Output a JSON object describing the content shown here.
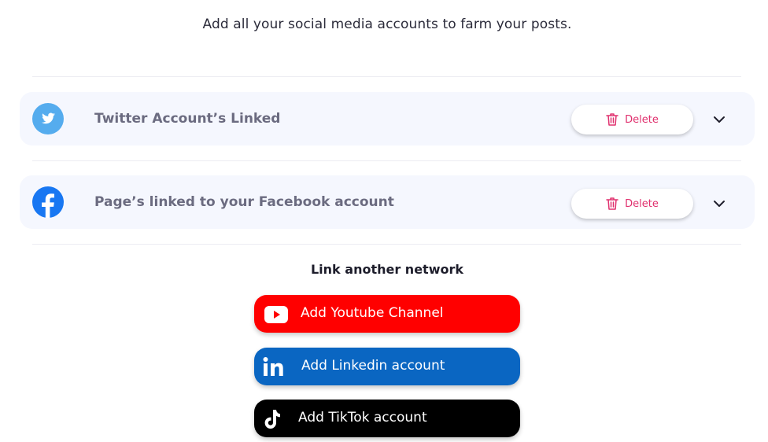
{
  "intro": "Add all your social media accounts to farm your posts.",
  "accounts": [
    {
      "title": "Twitter Account’s Linked",
      "delete_label": "Delete",
      "icon": "twitter-icon"
    },
    {
      "title": "Page’s linked to your Facebook account",
      "delete_label": "Delete",
      "icon": "facebook-icon"
    }
  ],
  "link_section": {
    "heading": "Link another network",
    "buttons": [
      {
        "label": "Add Youtube Channel",
        "icon": "youtube-icon",
        "color": "#ff0000"
      },
      {
        "label": "Add Linkedin account",
        "icon": "linkedin-icon",
        "color": "#0a66c2"
      },
      {
        "label": "Add TikTok account",
        "icon": "tiktok-icon",
        "color": "#000000"
      }
    ]
  },
  "colors": {
    "card_bg": "#f5f7fe",
    "delete_accent": "#e0306e",
    "twitter_blue": "#55acee",
    "facebook_blue": "#1877f2"
  }
}
